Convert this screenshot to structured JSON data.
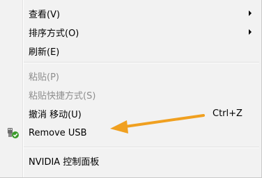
{
  "menu": {
    "items": [
      {
        "label": "查看(V)",
        "submenu": true
      },
      {
        "label": "排序方式(O)",
        "submenu": true
      },
      {
        "label": "刷新(E)"
      },
      {
        "label": "粘贴(P)",
        "disabled": true
      },
      {
        "label": "粘贴快捷方式(S)",
        "disabled": true
      },
      {
        "label": "撤消 移动(U)",
        "shortcut": "Ctrl+Z"
      },
      {
        "label": "Remove USB",
        "icon": "usb-remove-icon"
      },
      {
        "label": "NVIDIA 控制面板"
      }
    ]
  },
  "annotation": {
    "color": "#f0a020",
    "icon": "orange-arrow-icon"
  }
}
